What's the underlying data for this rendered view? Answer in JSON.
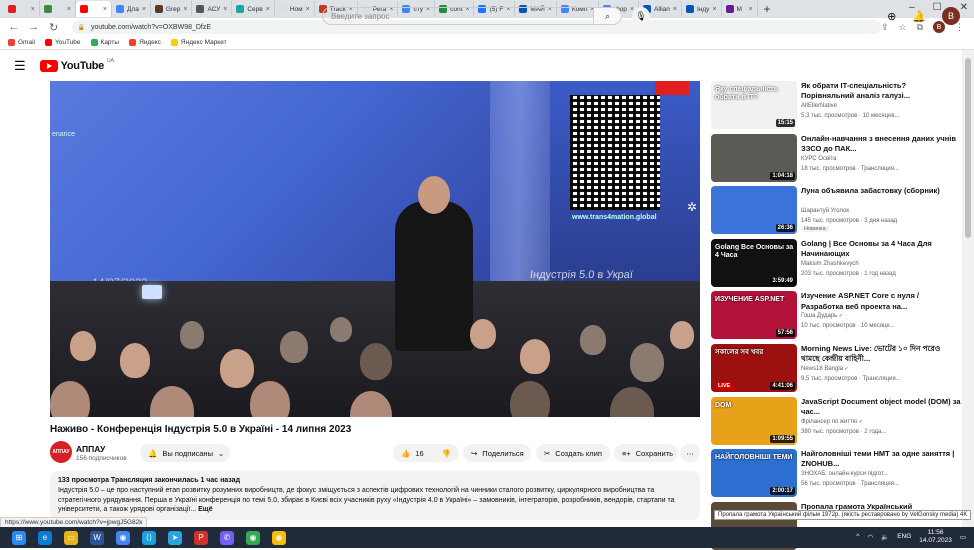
{
  "browser": {
    "tabs": [
      {
        "label": "",
        "color": "#e02020"
      },
      {
        "label": "",
        "color": "#3c8d3c"
      },
      {
        "label": "",
        "color": "#ff0000",
        "active": true
      },
      {
        "label": "Дла",
        "color": "#4285f4"
      },
      {
        "label": "Grep",
        "color": "#5a3a2a"
      },
      {
        "label": "АСУ",
        "color": "#555"
      },
      {
        "label": "Серв",
        "color": "#1aa6a6"
      },
      {
        "label": "Ном",
        "color": "#ddd"
      },
      {
        "label": "Track",
        "color": "#c0392b"
      },
      {
        "label": "Рега",
        "color": "#ddd"
      },
      {
        "label": "сту",
        "color": "#4285f4"
      },
      {
        "label": "cont",
        "color": "#1e8e3e"
      },
      {
        "label": "(5) F",
        "color": "#1877f2"
      },
      {
        "label": "МАЙ",
        "color": "#0057b7"
      },
      {
        "label": "Комп",
        "color": "#4285f4"
      },
      {
        "label": "фор",
        "color": "#4285f4"
      },
      {
        "label": "Allian",
        "color": "#0057b7"
      },
      {
        "label": "Інду",
        "color": "#0057b7"
      },
      {
        "label": "M",
        "color": "#6a1b9a"
      }
    ],
    "url": "youtube.com/watch?v=OXBW98_DfzE",
    "bookmarks": [
      {
        "label": "Gmail",
        "color": "#ea4335"
      },
      {
        "label": "YouTube",
        "color": "#ff0000"
      },
      {
        "label": "Карты",
        "color": "#34a853"
      },
      {
        "label": "Яндекс",
        "color": "#fc3f1d"
      },
      {
        "label": "Яндекс Маркет",
        "color": "#ffcc00"
      }
    ],
    "profile_initial": "B"
  },
  "youtube": {
    "logo_text": "YouTube",
    "logo_country": "UA",
    "search_placeholder": "Введите запрос",
    "avatar_initial": "B"
  },
  "video": {
    "overlay_text_left": "enance",
    "overlay_site": "www.trans4mation.global",
    "overlay_date": "14/07/2023",
    "overlay_title": "Індустрія 5.0 в Украї",
    "title": "Наживо - Конференція Індустрія 5.0 в Україні - 14 липня 2023",
    "channel": "АППАУ",
    "channel_avatar_text": "АППАУ",
    "subscribers": "156 подписчиков",
    "subscribed_label": "Вы подписаны",
    "likes": "16",
    "share_label": "Поделиться",
    "clip_label": "Создать клип",
    "save_label": "Сохранить",
    "desc_meta": "133 просмотра  Трансляция закончилась 1 час назад",
    "desc_text": "Індустрія 5.0 – це про наступний етап розвитку розумних виробництв, де фокус зміщується з аспектів цифрових технологій на чинники сталого розвитку, циркулярного виробництва та стратегічного урядування. Перша в Україні конференція по темі 5.0, збирає в Києві всіх учасників руху «Індустрія 4.0 в Україні» – замовників, інтеграторів, розробників, вендорів, стартапи та університети, а також урядові організації...",
    "desc_more": "Ещё"
  },
  "recommendations": [
    {
      "title": "Як обрати IT-спеціальність? Порівняльний аналіз галузі...",
      "channel": "AltEllerNative",
      "meta": "5,3 тыс. просмотров · 10 месяцев...",
      "duration": "15:15",
      "thumb_text": "Яку спеціальність обрати в IT?",
      "color": "#f1f1f1",
      "verified": false
    },
    {
      "title": "Онлайн-навчання з внесення даних учнів ЗЗСО до ПАК...",
      "channel": "КУРС Освіта",
      "meta": "18 тыс. просмотров · Трансляция...",
      "duration": "1:04:18",
      "thumb_text": "",
      "color": "#5b5a55",
      "verified": false
    },
    {
      "title": "Луна объявила забастовку (сборник)",
      "channel": "Шарантуй Уголок",
      "meta": "145 тыс. просмотров · 3 дня назад",
      "duration": "26:36",
      "thumb_text": "",
      "color": "#3a74d8",
      "badge": "Новинка",
      "verified": false
    },
    {
      "title": "Golang | Все Основы за 4 Часа Для Начинающих",
      "channel": "Maksim Zhashkevych",
      "meta": "203 тыс. просмотров · 1 год назад",
      "duration": "3:59:49",
      "thumb_text": "Golang Все Основы за 4 Часа",
      "color": "#111111",
      "verified": false
    },
    {
      "title": "Изучение ASP.NET Core с нуля / Разработка веб проекта на...",
      "channel": "Гоша Дударь",
      "meta": "10 тыс. просмотров · 10 месяце...",
      "duration": "57:56",
      "thumb_text": "ИЗУЧЕНИЕ ASP.NET",
      "color": "#b3123b",
      "verified": true
    },
    {
      "title": "Morning News Live: ভোটের ১০ দিন পরেও থামছে কেন্দ্রীয় বাহিনী...",
      "channel": "News18 Bangla",
      "meta": "9,5 тыс. просмотров · Трансляция...",
      "duration": "4:41:06",
      "thumb_text": "সকালের সব খবর",
      "color": "#9c1010",
      "live": "LIVE",
      "verified": true
    },
    {
      "title": "JavaScript Document object model (DOM) за час...",
      "channel": "Фрілансер по життю",
      "meta": "380 тыс. просмотров · 2 года...",
      "duration": "1:09:55",
      "thumb_text": "DOM",
      "color": "#e8a21a",
      "verified": true
    },
    {
      "title": "Найголовніші теми НМТ за одне заняття | ZNOHUB...",
      "channel": "ЗНОХАБ: онлайн-курси підгот...",
      "meta": "56 тыс. просмотров · Трансляция...",
      "duration": "2:00:17",
      "thumb_text": "НАЙГОЛОВНІШІ ТЕМИ",
      "color": "#2c6fd1",
      "verified": false
    },
    {
      "title": "Пропала грамота Український",
      "channel": "",
      "meta": "",
      "duration": "",
      "thumb_text": "",
      "color": "#5a4a3a",
      "verified": false
    }
  ],
  "tooltip": "Пропала грамота Український фільм 1972р. (якість реставровано by VelGonsky media) 4K",
  "status_url": "https://www.youtube.com/watch?v=jpwgJ5G82k",
  "taskbar": {
    "lang": "ENG",
    "time": "11:56",
    "date": "14.07.2023"
  }
}
